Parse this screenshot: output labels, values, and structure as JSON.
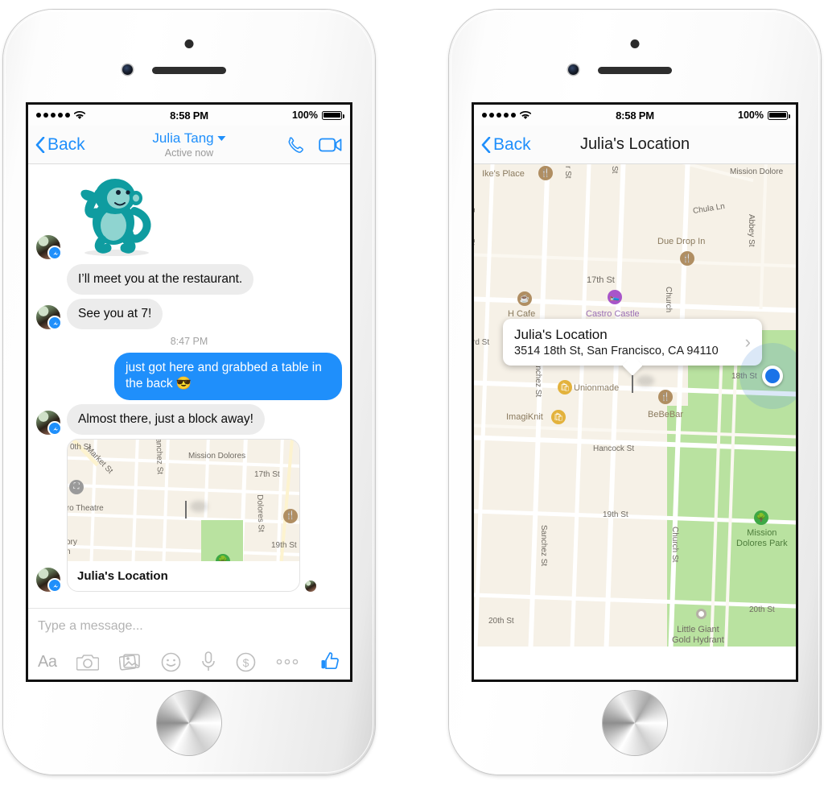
{
  "statusbar": {
    "signal_dots": 5,
    "wifi_icon": "wifi-icon",
    "time": "8:58 PM",
    "battery_pct": "100%",
    "battery_icon": "battery-full-icon"
  },
  "left_phone": {
    "navbar": {
      "back_label": "Back",
      "back_icon": "chevron-left-icon",
      "contact_name": "Julia Tang",
      "caret_icon": "caret-down-icon",
      "presence": "Active now",
      "call_icon": "phone-call-icon",
      "video_icon": "video-camera-icon"
    },
    "messages": [
      {
        "id": "m1",
        "type": "sticker",
        "from": "them",
        "sticker_name": "teal-monkey-sticker"
      },
      {
        "id": "m2",
        "type": "text",
        "from": "them",
        "text": "I’ll meet you at the restaurant."
      },
      {
        "id": "m3",
        "type": "text",
        "from": "them",
        "text": "See you at 7!"
      },
      {
        "id": "m4",
        "type": "timestamp",
        "text": "8:47 PM"
      },
      {
        "id": "m5",
        "type": "text",
        "from": "me",
        "text": "just got here and grabbed a table in the back 😎"
      },
      {
        "id": "m6",
        "type": "text",
        "from": "them",
        "text": "Almost there, just a block away!"
      },
      {
        "id": "m7",
        "type": "map",
        "from": "them",
        "card_label": "Julia's Location"
      }
    ],
    "composer": {
      "placeholder": "Type a message...",
      "value": "",
      "tools": [
        {
          "name": "text-format-button",
          "label": "Aa"
        },
        {
          "name": "camera-button",
          "label": ""
        },
        {
          "name": "photo-library-button",
          "label": ""
        },
        {
          "name": "sticker-emoji-button",
          "label": ""
        },
        {
          "name": "voice-record-button",
          "label": ""
        },
        {
          "name": "payment-button",
          "label": ""
        },
        {
          "name": "more-options-button",
          "label": ""
        },
        {
          "name": "like-thumbs-up-button",
          "label": ""
        }
      ]
    },
    "thread_map": {
      "streets": [
        "Market St",
        "Sanchez St",
        "Mission Dolores",
        "17th St",
        "Dolores St",
        "19th St",
        "0th St"
      ],
      "places": [
        "Castro Theatre",
        "ory"
      ]
    }
  },
  "right_phone": {
    "navbar": {
      "back_label": "Back",
      "back_icon": "chevron-left-icon",
      "title": "Julia's Location"
    },
    "callout": {
      "title": "Julia's Location",
      "address": "3514 18th St, San Francisco, CA 94110",
      "chevron_icon": "chevron-right-icon"
    },
    "map": {
      "streets": [
        "Prosper St",
        "Chula Ln",
        "Abbey St",
        "17th St",
        "Church St",
        "Sanchez St",
        "18th St",
        "Hancock St",
        "19th St",
        "20th St",
        "rd St",
        "St"
      ],
      "places": [
        {
          "name": "Ike's Place",
          "icon": "restaurant-icon"
        },
        {
          "name": "Due Drop In",
          "icon": "restaurant-icon"
        },
        {
          "name": "H Cafe",
          "icon": "cafe-icon"
        },
        {
          "name": "Castro Castle",
          "icon": "lodging-icon"
        },
        {
          "name": "Mission Dolores",
          "icon": "label-only"
        },
        {
          "name": "Unionmade",
          "icon": "shopping-icon"
        },
        {
          "name": "ImagiKnit",
          "icon": "shopping-icon"
        },
        {
          "name": "BeBeBar",
          "icon": "restaurant-icon"
        },
        {
          "name": "Mission Dolores Park",
          "icon": "park-icon"
        },
        {
          "name": "Little Giant Gold Hydrant",
          "icon": "marker-icon"
        }
      ],
      "pin_icon": "location-pin-icon",
      "user_location_icon": "user-location-dot"
    }
  },
  "colors": {
    "messenger_blue": "#1f8ffb",
    "incoming_bubble": "#ececec",
    "map_land": "#f6f1e7",
    "map_park": "#b9e2a0",
    "pin_red": "#e8261c"
  }
}
